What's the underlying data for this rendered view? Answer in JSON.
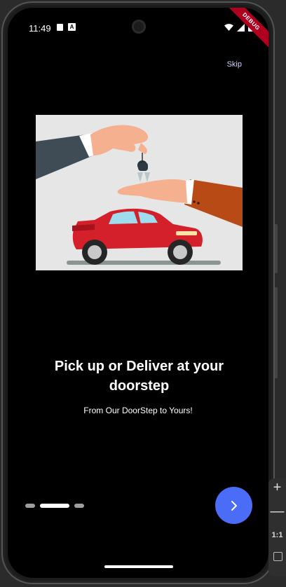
{
  "status_bar": {
    "time": "11:49",
    "icons": [
      "sd-card-icon",
      "a-icon",
      "wifi-icon",
      "signal-icon",
      "battery-icon"
    ]
  },
  "debug_banner": "DEBUG",
  "skip_label": "Skip",
  "illustration": {
    "icon": "car-key-handover-illustration"
  },
  "title": "Pick up or Deliver at your doorstep",
  "subtitle": "From Our DoorStep to Yours!",
  "pagination": {
    "pages": 3,
    "active_index": 1
  },
  "next_button": {
    "icon": "chevron-right-icon"
  },
  "emulator_side_panel": {
    "zoom_in": "+",
    "zoom_out": "—",
    "ratio": "1:1"
  },
  "colors": {
    "accent": "#4a6cf7",
    "background": "#000000",
    "car": "#d3202a",
    "debug": "#b00020"
  }
}
